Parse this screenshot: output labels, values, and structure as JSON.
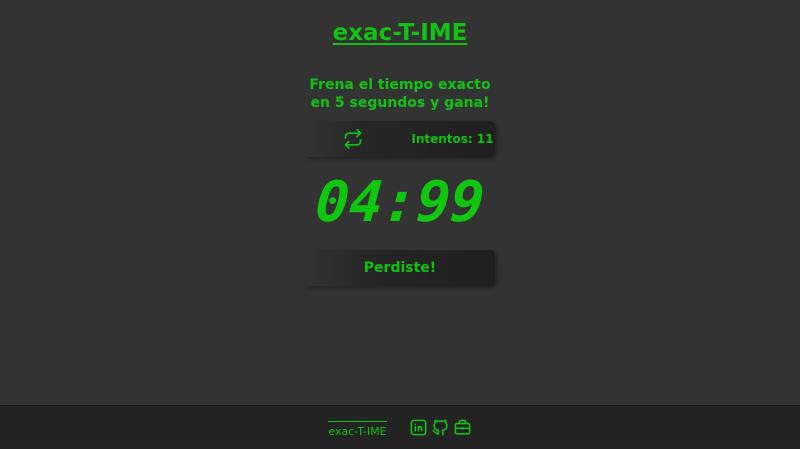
{
  "header": {
    "title": "exac-T-IME"
  },
  "intro": {
    "line1": "Frena el tiempo exacto",
    "line2": "en 5 segundos y gana!"
  },
  "controls": {
    "reset_icon": "repeat-icon",
    "tries_label": "Intentos: 11"
  },
  "timer": {
    "display": "04:99"
  },
  "result": {
    "text": "Perdiste!"
  },
  "footer": {
    "brand": "exac-T-IME",
    "icons": [
      "linkedin-icon",
      "github-icon",
      "briefcase-icon"
    ]
  },
  "colors": {
    "accent": "#12c212",
    "background": "#333333",
    "footer_bg": "#232323"
  }
}
